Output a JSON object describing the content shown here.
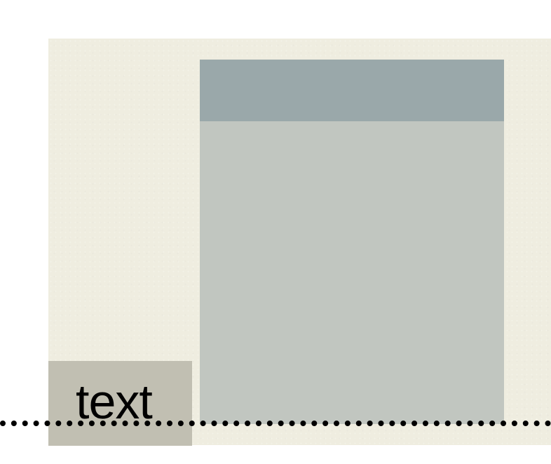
{
  "diagram": {
    "label_text": "text",
    "colors": {
      "canvas": "#efede0",
      "block_body": "#c1c6c0",
      "block_header": "#9aa8aa",
      "text_box": "#c1bfb2",
      "baseline": "#000000",
      "text": "#000000"
    }
  }
}
